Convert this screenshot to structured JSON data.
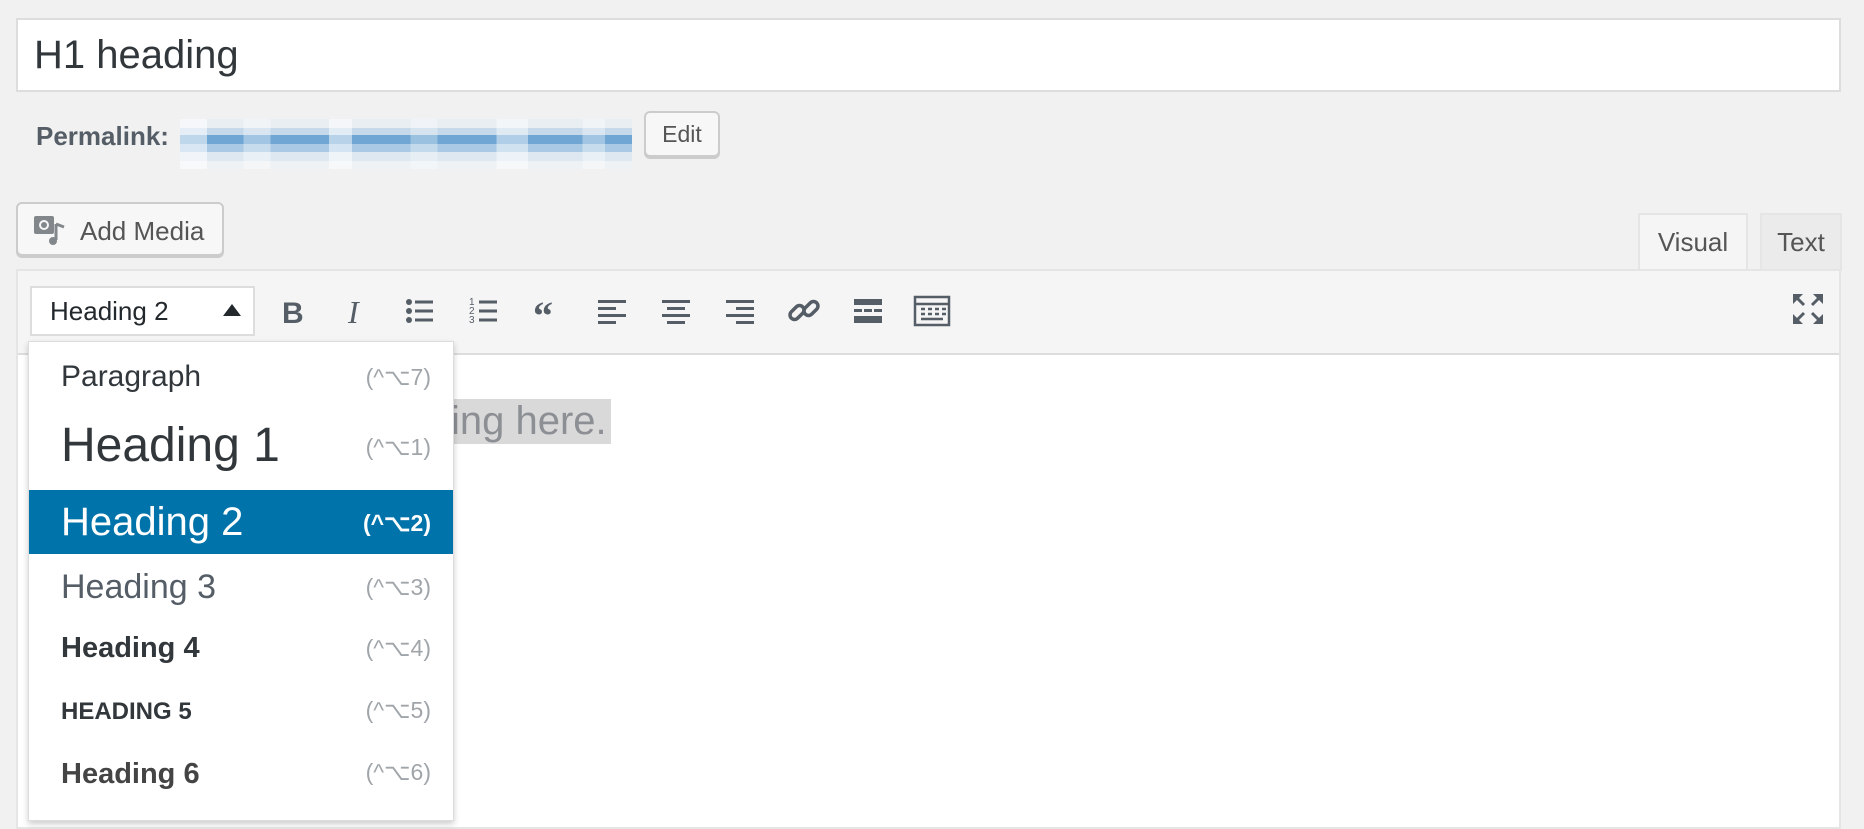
{
  "title_field": {
    "value": "H1 heading"
  },
  "permalink": {
    "label": "Permalink:",
    "edit_label": "Edit"
  },
  "media": {
    "add_media_label": "Add Media"
  },
  "tabs": [
    {
      "label": "Visual",
      "active": true
    },
    {
      "label": "Text",
      "active": false
    }
  ],
  "toolbar": {
    "format_selected": "Heading 2",
    "buttons": [
      "bold-icon",
      "italic-icon",
      "bulleted-list-icon",
      "numbered-list-icon",
      "blockquote-icon",
      "align-left-icon",
      "align-center-icon",
      "align-right-icon",
      "link-icon",
      "read-more-icon",
      "toolbar-toggle-icon"
    ],
    "fullscreen_icon": "fullscreen-icon"
  },
  "content": {
    "visible_text": "heading here."
  },
  "format_dropdown": {
    "items": [
      {
        "label": "Paragraph",
        "shortcut": "(^⌥7)"
      },
      {
        "label": "Heading 1",
        "shortcut": "(^⌥1)"
      },
      {
        "label": "Heading 2",
        "shortcut": "(^⌥2)",
        "selected": true
      },
      {
        "label": "Heading 3",
        "shortcut": "(^⌥3)"
      },
      {
        "label": "Heading 4",
        "shortcut": "(^⌥4)"
      },
      {
        "label": "HEADING 5",
        "shortcut": "(^⌥5)"
      },
      {
        "label": "Heading 6",
        "shortcut": "(^⌥6)"
      }
    ]
  },
  "colors": {
    "accent": "#0073aa",
    "background": "#f1f1f1"
  }
}
